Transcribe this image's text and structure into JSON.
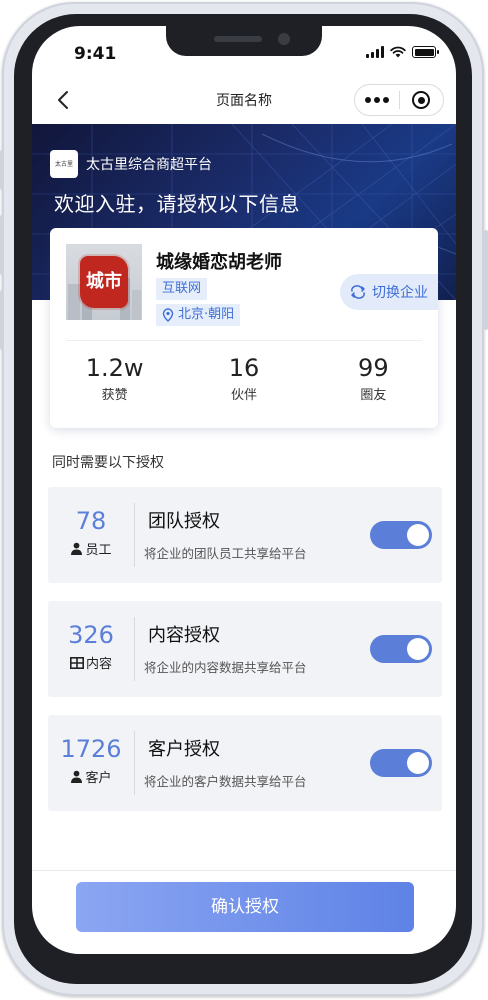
{
  "status_bar": {
    "time": "9:41"
  },
  "nav": {
    "title": "页面名称"
  },
  "banner": {
    "brand_logo_text": "太古里",
    "brand_name": "太古里综合商超平台",
    "headline": "欢迎入驻，请授权以下信息"
  },
  "company": {
    "logo_text": "城市",
    "name": "城缘婚恋胡老师",
    "industry": "互联网",
    "location": "北京·朝阳",
    "switch_label": "切换企业",
    "stats": [
      {
        "value": "1.2w",
        "label": "获赞"
      },
      {
        "value": "16",
        "label": "伙伴"
      },
      {
        "value": "99",
        "label": "圈友"
      }
    ]
  },
  "auth": {
    "section_title": "同时需要以下授权",
    "items": [
      {
        "count": "78",
        "unit": "员工",
        "unit_icon": "person-icon",
        "title": "团队授权",
        "desc": "将企业的团队员工共享给平台",
        "enabled": true
      },
      {
        "count": "326",
        "unit": "内容",
        "unit_icon": "grid-icon",
        "title": "内容授权",
        "desc": "将企业的内容数据共享给平台",
        "enabled": true
      },
      {
        "count": "1726",
        "unit": "客户",
        "unit_icon": "person-icon",
        "title": "客户授权",
        "desc": "将企业的客户数据共享给平台",
        "enabled": true
      }
    ]
  },
  "footer": {
    "confirm_label": "确认授权"
  },
  "colors": {
    "accent": "#5b7fd8",
    "tag_bg": "#e6eefc",
    "banner_dark": "#11163a",
    "card_bg": "#f2f3f7"
  }
}
